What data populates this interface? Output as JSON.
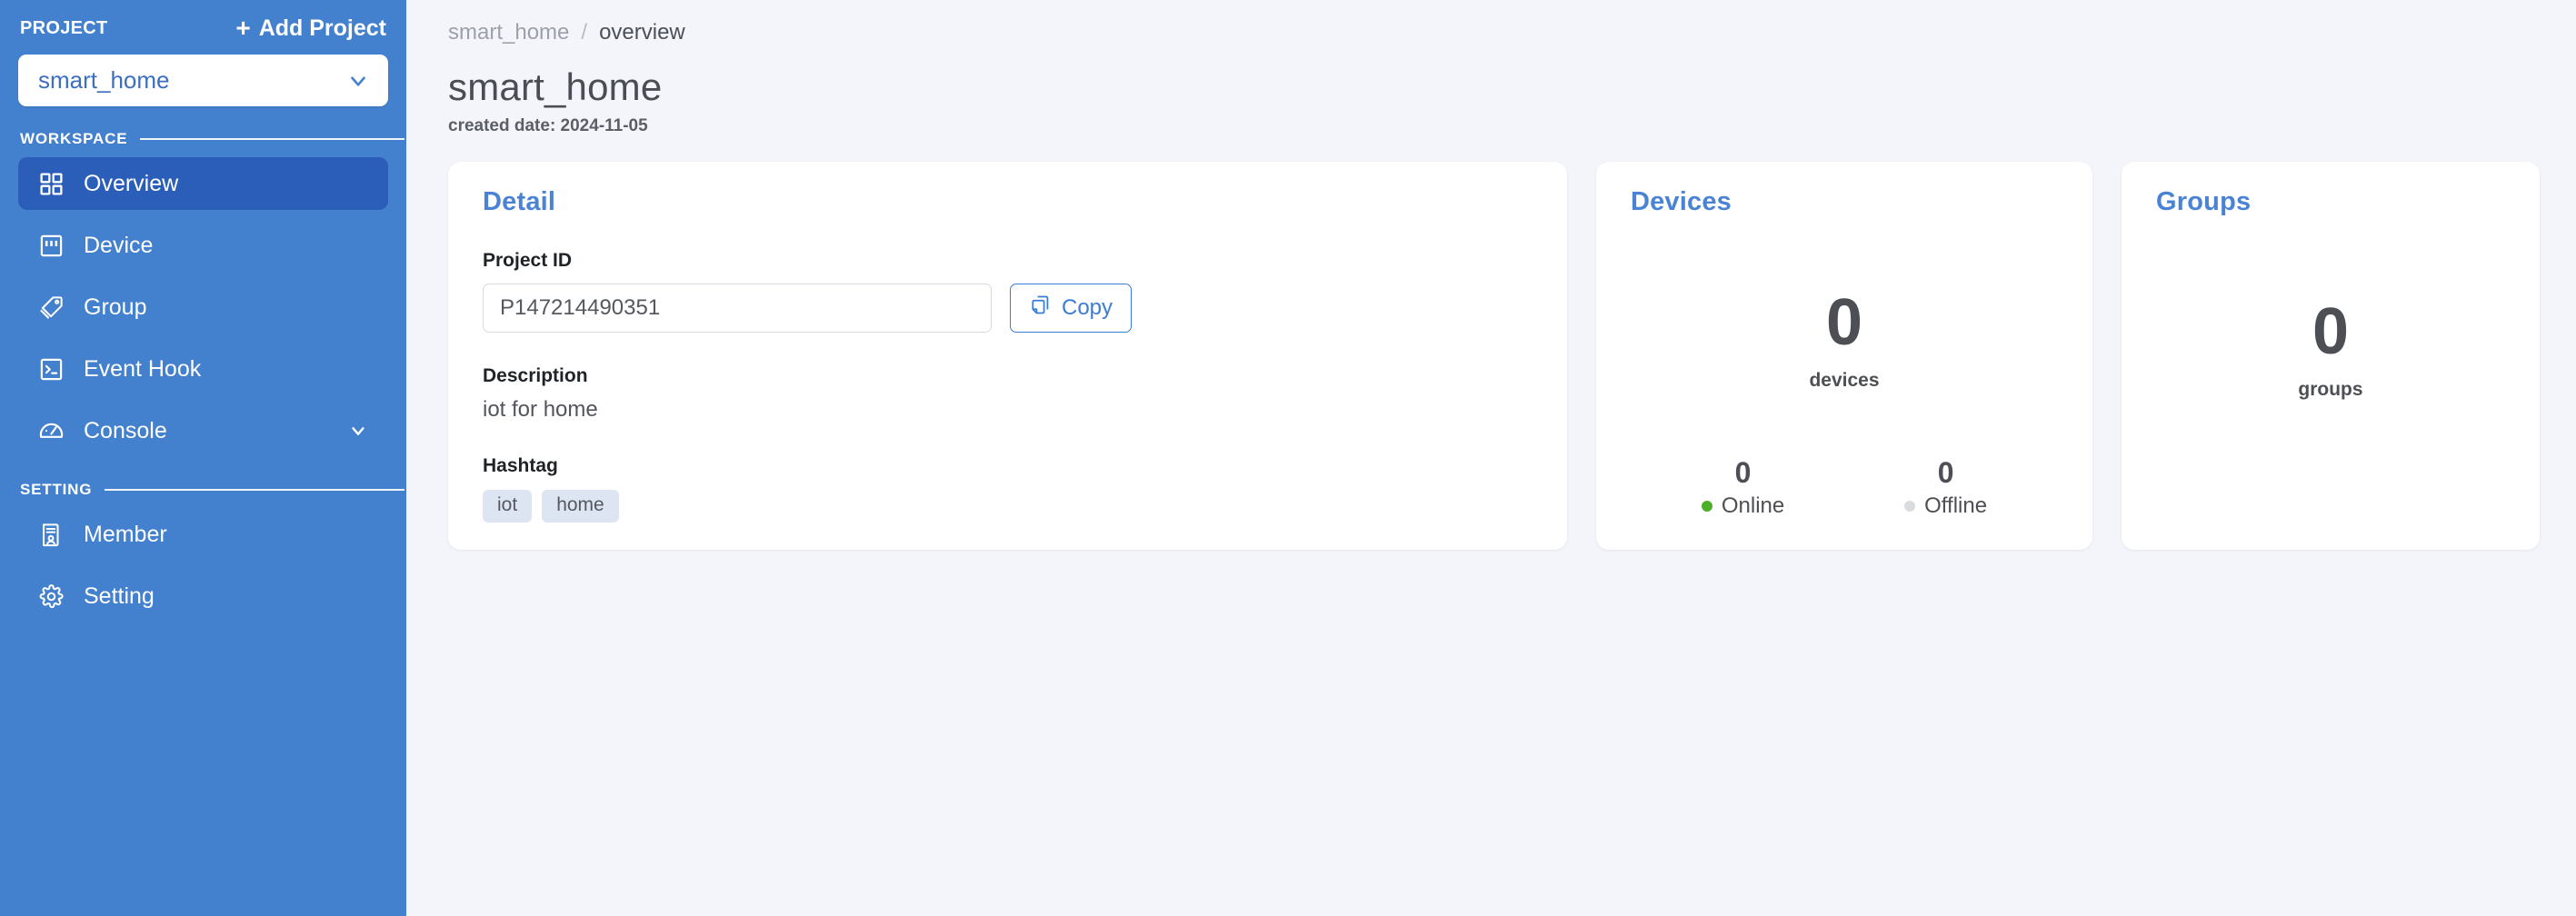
{
  "sidebar": {
    "project_label": "PROJECT",
    "add_project_label": "Add Project",
    "add_project_plus": "+",
    "selected_project": "smart_home",
    "chevron_icon": "chevron-down-icon",
    "sections": [
      {
        "title": "WORKSPACE"
      },
      {
        "title": "SETTING"
      }
    ],
    "workspace_items": [
      {
        "label": "Overview",
        "icon": "grid-icon",
        "active": true,
        "has_caret": false
      },
      {
        "label": "Device",
        "icon": "chip-icon",
        "active": false,
        "has_caret": false
      },
      {
        "label": "Group",
        "icon": "tag-icon",
        "active": false,
        "has_caret": false
      },
      {
        "label": "Event Hook",
        "icon": "terminal-icon",
        "active": false,
        "has_caret": false
      },
      {
        "label": "Console",
        "icon": "gauge-icon",
        "active": false,
        "has_caret": true
      }
    ],
    "setting_items": [
      {
        "label": "Member",
        "icon": "member-doc-icon",
        "active": false
      },
      {
        "label": "Setting",
        "icon": "gear-icon",
        "active": false
      }
    ]
  },
  "header": {
    "breadcrumb_root": "smart_home",
    "breadcrumb_separator": "/",
    "breadcrumb_current": "overview",
    "page_title": "smart_home",
    "created_date": "created date: 2024-11-05"
  },
  "detail_card": {
    "title": "Detail",
    "project_id_label": "Project ID",
    "project_id_value": "P147214490351",
    "project_id_placeholder": "Project ID",
    "copy_button_label": "Copy",
    "copy_icon": "copy-icon",
    "description_label": "Description",
    "description_value": "iot for home",
    "hashtag_label": "Hashtag",
    "hashtags": [
      "iot",
      "home"
    ]
  },
  "devices_card": {
    "title": "Devices",
    "count": "0",
    "unit": "devices",
    "online_count": "0",
    "online_label": "Online",
    "online_color": "#4caf28",
    "offline_count": "0",
    "offline_label": "Offline",
    "offline_color": "#d9dbdf"
  },
  "groups_card": {
    "title": "Groups",
    "count": "0",
    "unit": "groups"
  },
  "colors": {
    "sidebar_bg": "#4380ce",
    "sidebar_active": "#2b5eb8",
    "accent_blue": "#4b83d4",
    "page_bg": "#f4f5fa",
    "card_bg": "#ffffff"
  }
}
